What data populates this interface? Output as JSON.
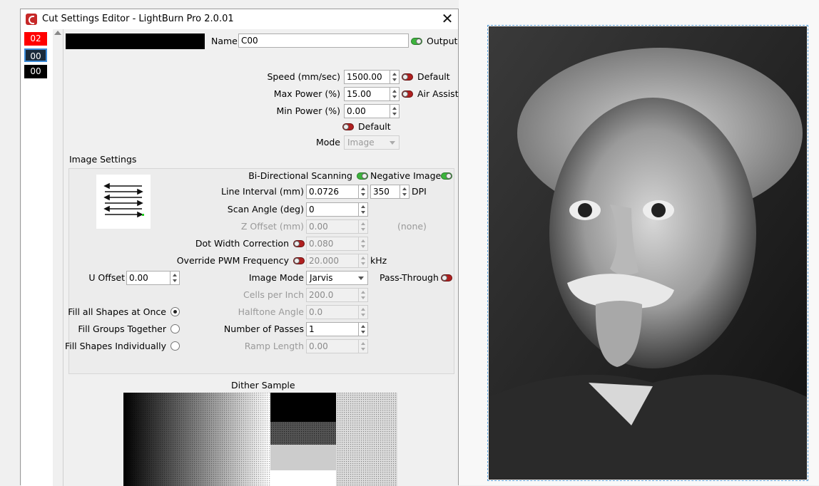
{
  "window": {
    "title": "Cut Settings Editor - LightBurn Pro 2.0.01",
    "close_glyph": "✕"
  },
  "layers": [
    {
      "label": "02",
      "color": "#ff0000"
    },
    {
      "label": "00",
      "color": "#1a2a3a"
    },
    {
      "label": "00",
      "color": "#000000"
    }
  ],
  "header": {
    "name_label": "Name",
    "name_value": "C00",
    "output_label": "Output",
    "output_on": true
  },
  "basic": {
    "speed_label": "Speed (mm/sec)",
    "speed_value": "1500.00",
    "speed_default_label": "Default",
    "max_power_label": "Max Power (%)",
    "max_power_value": "15.00",
    "air_assist_label": "Air Assist",
    "min_power_label": "Min Power (%)",
    "min_power_value": "0.00",
    "default_label": "Default",
    "mode_label": "Mode",
    "mode_value": "Image"
  },
  "image_settings": {
    "section_label": "Image Settings",
    "bidir_label": "Bi-Directional Scanning",
    "negative_label": "Negative Image",
    "line_interval_label": "Line Interval (mm)",
    "line_interval_value": "0.0726",
    "dpi_value": "350",
    "dpi_label": "DPI",
    "scan_angle_label": "Scan Angle (deg)",
    "scan_angle_value": "0",
    "z_offset_label": "Z Offset (mm)",
    "z_offset_value": "0.00",
    "z_offset_note": "(none)",
    "dot_width_label": "Dot Width Correction",
    "dot_width_value": "0.080",
    "pwm_label": "Override PWM Frequency",
    "pwm_value": "20.000",
    "pwm_unit": "kHz",
    "u_offset_label": "U Offset",
    "u_offset_value": "0.00",
    "image_mode_label": "Image Mode",
    "image_mode_value": "Jarvis",
    "pass_through_label": "Pass-Through",
    "cells_label": "Cells per Inch",
    "cells_value": "200.0",
    "fill_all_label": "Fill all Shapes at Once",
    "halftone_label": "Halftone Angle",
    "halftone_value": "0.0",
    "fill_groups_label": "Fill Groups Together",
    "passes_label": "Number of Passes",
    "passes_value": "1",
    "fill_individual_label": "Fill Shapes Individually",
    "ramp_label": "Ramp Length",
    "ramp_value": "0.00"
  },
  "dither": {
    "label": "Dither Sample"
  }
}
